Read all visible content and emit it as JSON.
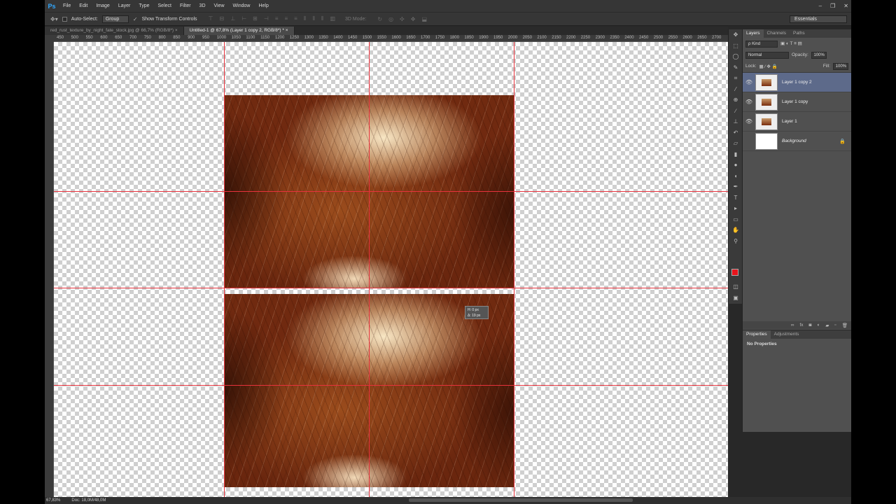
{
  "app": {
    "logo": "Ps"
  },
  "menu": [
    "File",
    "Edit",
    "Image",
    "Layer",
    "Type",
    "Select",
    "Filter",
    "3D",
    "View",
    "Window",
    "Help"
  ],
  "window_controls": [
    "–",
    "❐",
    "✕"
  ],
  "options_bar": {
    "auto_select_label": "Auto-Select:",
    "auto_select_value": "Group",
    "show_transform_label": "Show Transform Controls",
    "mode_3d_label": "3D Mode:",
    "workspace": "Essentials"
  },
  "tabs": [
    {
      "label": "red_rust_texture_by_night_fate_stock.jpg @ 66,7% (RGB/8*)",
      "close": "×"
    },
    {
      "label": "Untitled-1 @ 67,8% (Layer 1 copy 2, RGB/8*) *",
      "close": "×"
    }
  ],
  "ruler_ticks": [
    "450",
    "500",
    "550",
    "600",
    "650",
    "700",
    "750",
    "800",
    "850",
    "900",
    "950",
    "1000",
    "1050",
    "1100",
    "1150",
    "1200",
    "1250",
    "1300",
    "1350",
    "1400",
    "1450",
    "1500",
    "1550",
    "1600",
    "1650",
    "1700",
    "1750",
    "1800",
    "1850",
    "1900",
    "1950",
    "2000",
    "2050",
    "2100",
    "2150",
    "2200",
    "2250",
    "2300",
    "2350",
    "2400",
    "2450",
    "2500",
    "2550",
    "2600",
    "2650",
    "2700"
  ],
  "tooltip": {
    "line1": "H: 0 px",
    "line2": "Δ: 19 px"
  },
  "status": {
    "zoom": "67,83%",
    "doc": "Doc: 18,0M/48,0M"
  },
  "tools": [
    "move-tool",
    "marquee-tool",
    "lasso-tool",
    "quick-select-tool",
    "crop-tool",
    "eyedropper-tool",
    "healing-tool",
    "brush-tool",
    "stamp-tool",
    "history-brush-tool",
    "eraser-tool",
    "gradient-tool",
    "blur-tool",
    "dodge-tool",
    "pen-tool",
    "type-tool",
    "path-select-tool",
    "shape-tool",
    "hand-tool",
    "zoom-tool"
  ],
  "colors": {
    "foreground": "#e8141c",
    "background": "#000000",
    "guide": "#e8323c",
    "selected_layer": "#5d6a8a"
  },
  "layers_panel": {
    "tabs": [
      "Layers",
      "Channels",
      "Paths"
    ],
    "kind_label": "ρ Kind",
    "blend_mode": "Normal",
    "opacity_label": "Opacity:",
    "opacity_value": "100%",
    "lock_label": "Lock:",
    "fill_label": "Fill:",
    "fill_value": "100%",
    "layers": [
      {
        "name": "Layer 1 copy 2",
        "visible": true,
        "selected": true
      },
      {
        "name": "Layer 1 copy",
        "visible": true,
        "selected": false
      },
      {
        "name": "Layer 1",
        "visible": true,
        "selected": false
      },
      {
        "name": "Background",
        "visible": false,
        "selected": false,
        "locked": true
      }
    ]
  },
  "properties_panel": {
    "tabs": [
      "Properties",
      "Adjustments"
    ],
    "empty_text": "No Properties"
  }
}
